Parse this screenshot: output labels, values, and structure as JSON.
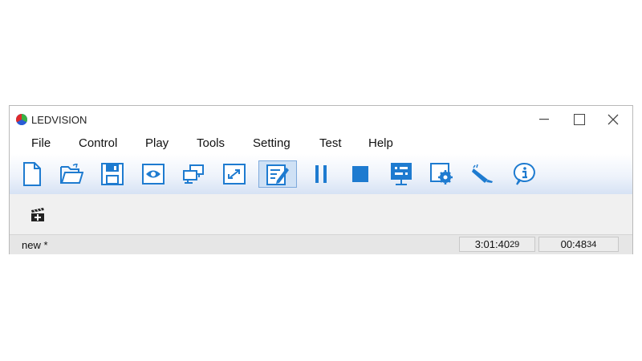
{
  "window": {
    "title": "LEDVISION"
  },
  "menu": {
    "items": [
      {
        "label": "File"
      },
      {
        "label": "Control"
      },
      {
        "label": "Play"
      },
      {
        "label": "Tools"
      },
      {
        "label": "Setting"
      },
      {
        "label": "Test"
      },
      {
        "label": "Help"
      }
    ]
  },
  "toolbar": {
    "icons": [
      "new-file-icon",
      "open-folder-icon",
      "save-icon",
      "preview-eye-icon",
      "network-screens-icon",
      "fullscreen-icon",
      "edit-icon",
      "pause-icon",
      "stop-icon",
      "screen-settings-icon",
      "settings-gear-icon",
      "broadcast-icon",
      "info-icon"
    ],
    "active": "edit-icon",
    "accent_color": "#1e7bd0"
  },
  "status": {
    "file": "new *",
    "time_main": "3:01:40",
    "time_main_frames": "29",
    "time_elapsed": "00:48",
    "time_elapsed_frames": "34"
  }
}
